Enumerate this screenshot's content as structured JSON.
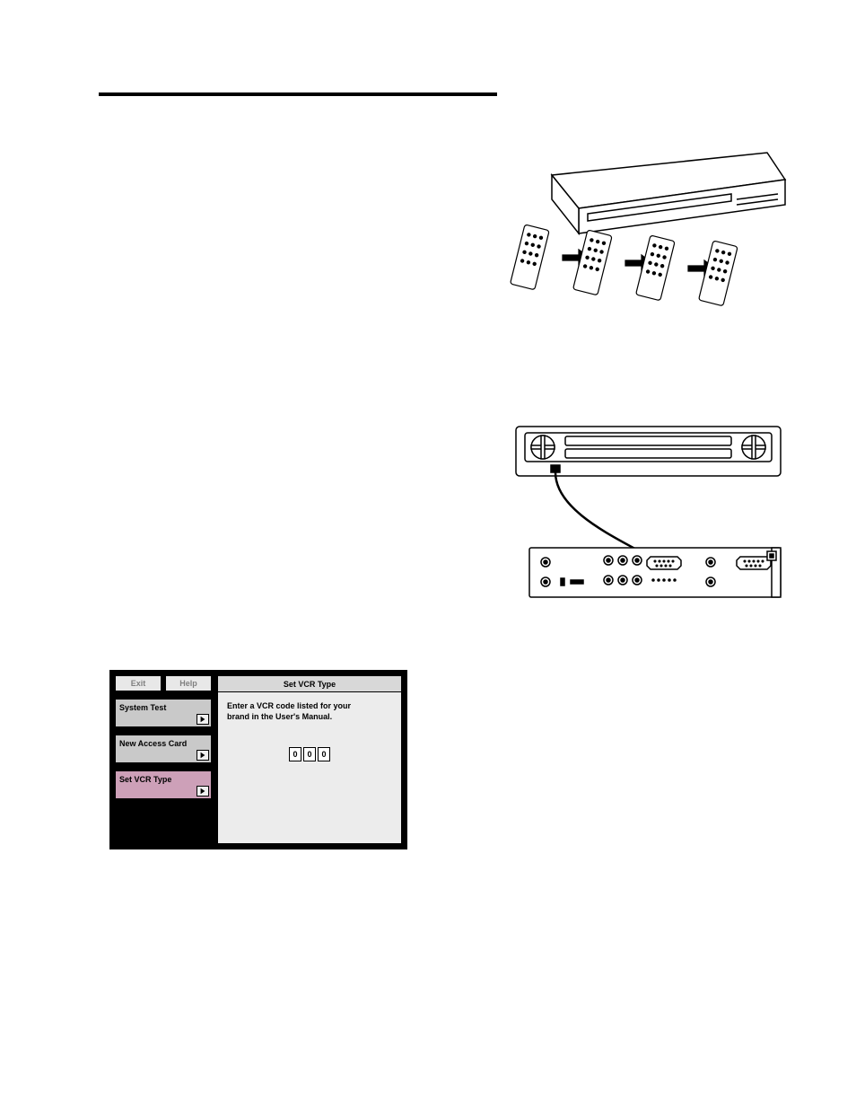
{
  "osd": {
    "buttons": {
      "exit": "Exit",
      "help": "Help"
    },
    "items": [
      {
        "label": "System Test"
      },
      {
        "label": "New Access Card"
      },
      {
        "label": "Set VCR Type"
      }
    ],
    "panel": {
      "title": "Set VCR Type",
      "instruction_line1": "Enter a VCR code listed for your",
      "instruction_line2": "brand  in the User's Manual.",
      "digits": [
        "0",
        "0",
        "0"
      ]
    }
  },
  "figures": {
    "receiver_remotes": "receiver-with-remotes-illustration",
    "vcr_backpanel": "vcr-to-receiver-back-panel-illustration"
  }
}
